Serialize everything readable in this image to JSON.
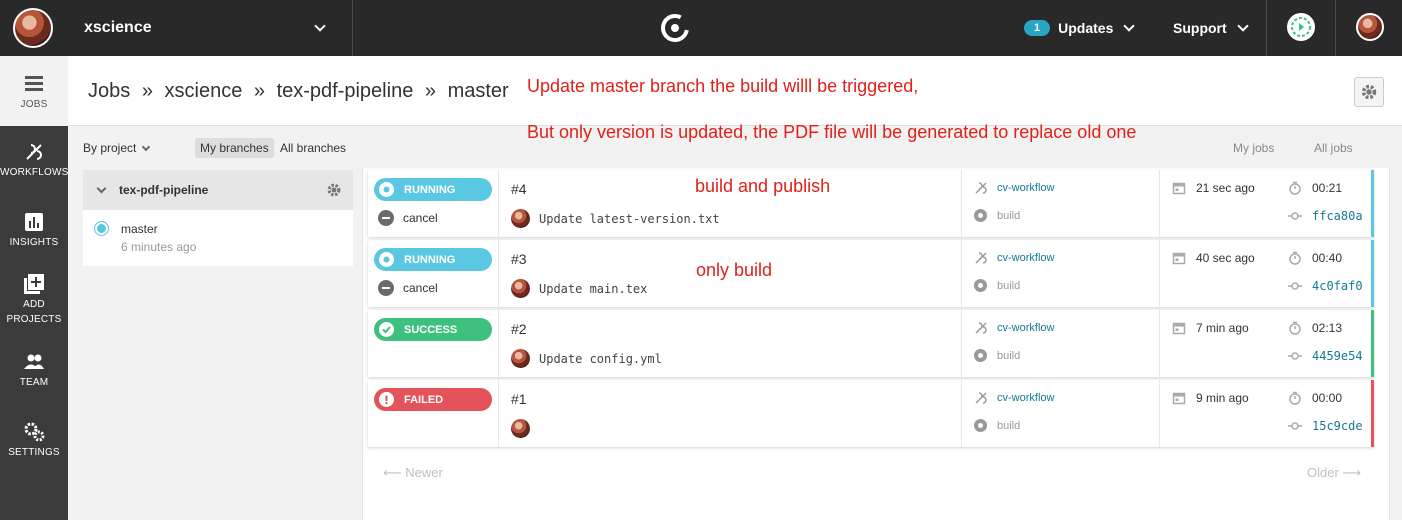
{
  "topbar": {
    "org_name": "xscience",
    "updates_count": "1",
    "updates_label": "Updates",
    "support_label": "Support"
  },
  "nav": {
    "items": [
      {
        "label": "JOBS",
        "icon": "jobs-icon",
        "active": true
      },
      {
        "label": "WORKFLOWS",
        "icon": "workflows-icon"
      },
      {
        "label": "INSIGHTS",
        "icon": "insights-icon"
      },
      {
        "label_1": "ADD",
        "label_2": "PROJECTS",
        "icon": "add-projects-icon"
      },
      {
        "label": "TEAM",
        "icon": "team-icon"
      },
      {
        "label": "SETTINGS",
        "icon": "settings-icon"
      }
    ]
  },
  "breadcrumb": {
    "parts": [
      "Jobs",
      "»",
      "xscience",
      "»",
      "tex-pdf-pipeline",
      "»",
      "master"
    ]
  },
  "annotations": {
    "line1": "Update master branch the build willl be triggered,",
    "line2": "But only version is updated, the PDF file will be generated to replace old one",
    "row1": "build and publish",
    "row2": "only build"
  },
  "filters": {
    "by_project": "By project",
    "my_branches": "My branches",
    "all_branches": "All branches",
    "my_jobs": "My jobs",
    "all_jobs": "All jobs"
  },
  "project": {
    "name": "tex-pdf-pipeline",
    "branch": "master",
    "branch_time": "6 minutes ago"
  },
  "builds": [
    {
      "status": "RUNNING",
      "color": "#5bc8e3",
      "cancel": "cancel",
      "number": "#4",
      "commit": "Update latest-version.txt",
      "workflow": "cv-workflow",
      "job": "build",
      "when": "21 sec ago",
      "duration": "00:21",
      "sha": "ffca80a"
    },
    {
      "status": "RUNNING",
      "color": "#5bc8e3",
      "cancel": "cancel",
      "number": "#3",
      "commit": "Update main.tex",
      "workflow": "cv-workflow",
      "job": "build",
      "when": "40 sec ago",
      "duration": "00:40",
      "sha": "4c0faf0"
    },
    {
      "status": "SUCCESS",
      "color": "#3ec07e",
      "number": "#2",
      "commit": "Update config.yml",
      "workflow": "cv-workflow",
      "job": "build",
      "when": "7 min ago",
      "duration": "02:13",
      "sha": "4459e54"
    },
    {
      "status": "FAILED",
      "color": "#e4535c",
      "number": "#1",
      "commit": "",
      "workflow": "cv-workflow",
      "job": "build",
      "when": "9 min ago",
      "duration": "00:00",
      "sha": "15c9cde"
    }
  ],
  "pager": {
    "newer": "Newer",
    "older": "Older"
  }
}
